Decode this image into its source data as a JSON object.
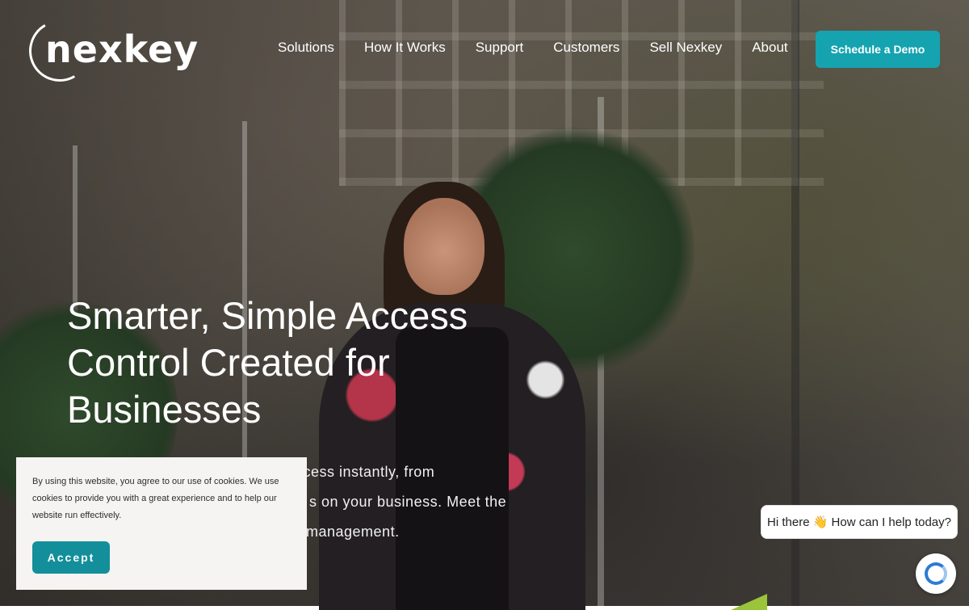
{
  "header": {
    "logo_text": "nexkey",
    "nav": [
      "Solutions",
      "How It Works",
      "Support",
      "Customers",
      "Sell Nexkey",
      "About"
    ],
    "cta_label": "Schedule a Demo"
  },
  "hero": {
    "title": "Smarter, Simple Access Control Created for Businesses",
    "description": "ccess instantly, from s on your business. Meet the management."
  },
  "cookie_notice": {
    "text": "By using this website, you agree to our use of cookies. We use cookies to provide you with a great experience and to help our website run effectively.",
    "accept_label": "Accept"
  },
  "chat": {
    "greeting": "Hi there 👋 How can I help today?"
  },
  "colors": {
    "accent": "#15a3b0",
    "accept_button": "#138f9b",
    "chat_icon": "#2c7bd6"
  }
}
